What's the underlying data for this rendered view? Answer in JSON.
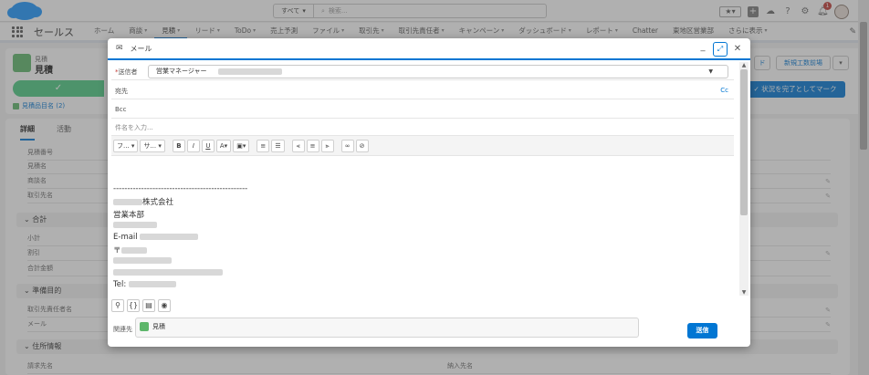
{
  "topbar": {
    "search_scope": "すべて",
    "search_placeholder": "検索..."
  },
  "nav": {
    "app_name": "セールス",
    "items": [
      "ホーム",
      "商談",
      "見積",
      "リード",
      "ToDo",
      "売上予測",
      "ファイル",
      "取引先",
      "取引先責任者",
      "キャンペーン",
      "ダッシュボード",
      "レポート",
      "Chatter",
      "東地区営業部",
      "さらに表示"
    ]
  },
  "record": {
    "type_label": "見積",
    "name": "見積",
    "related_link": "見積品目名 (2)",
    "btn_fragment": "ド",
    "btn_new_quote": "新規工数前場",
    "complete_label": "✓ 状況を完了としてマーク",
    "path_check": "✓"
  },
  "detail": {
    "tabs": [
      "詳細",
      "活動"
    ],
    "fields_top": [
      "見積番号",
      "見積名",
      "商談名",
      "取引先名"
    ],
    "section_total": "合計",
    "fields_total": [
      "小計",
      "割引",
      "合計金額"
    ],
    "section_prepare": "準備目的",
    "fields_prepare": [
      "取引先責任者名",
      "メール"
    ],
    "section_address": "住所情報",
    "fields_address": [
      "請求先名"
    ],
    "right_label": "納入先名"
  },
  "modal": {
    "title": "メール",
    "from_label": "送信者",
    "from_value": "営業マネージャー",
    "to_label": "宛先",
    "cc_link": "Cc",
    "bcc_label": "Bcc",
    "subject_placeholder": "件名を入力...",
    "toolbar": {
      "font": "フ...",
      "size": "サ...",
      "bold": "B",
      "italic": "I",
      "underline": "U",
      "text_color": "A",
      "image": "▣"
    },
    "signature": {
      "divider": "------------------------------------------------",
      "company": "株式会社",
      "department": "営業本部",
      "email_label": "E-mail",
      "postal": "〒",
      "tel_label": "Tel:"
    },
    "related_label": "関連先",
    "related_value": "見積",
    "send_label": "送信"
  }
}
